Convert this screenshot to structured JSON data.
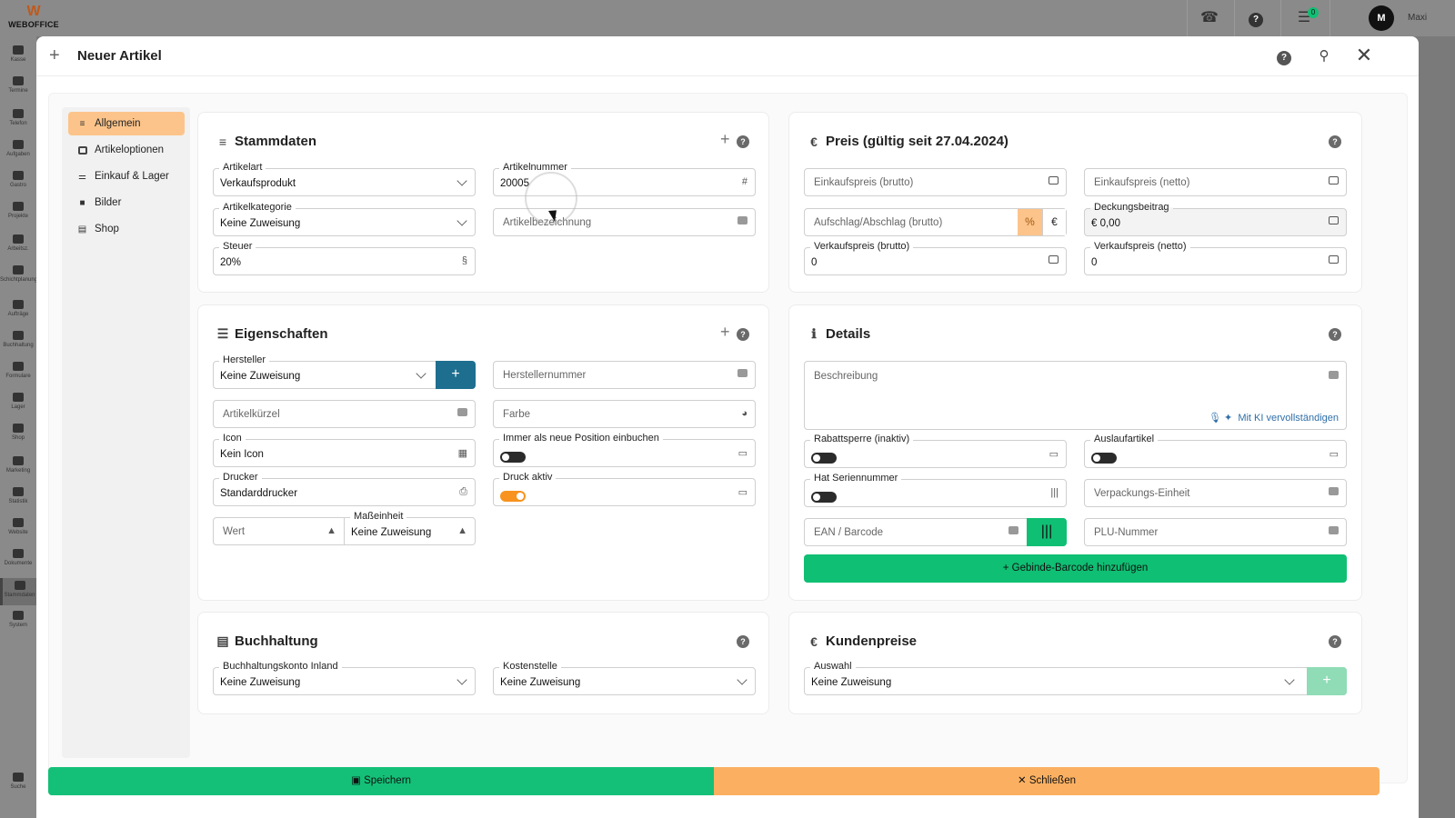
{
  "app": {
    "logo_text": "WEBOFFICE",
    "user_initial": "M",
    "user_name": "Maxi",
    "task_badge": "0"
  },
  "bg_sidebar": [
    "Kasse",
    "Termine",
    "Telefon",
    "Aufgaben",
    "Gastro",
    "Projekte",
    "Arbeitsz.",
    "Schichtplanung",
    "Aufträge",
    "Buchhaltung",
    "Formulare",
    "Lager",
    "Shop",
    "Marketing",
    "Statistik",
    "Website",
    "Dokumente",
    "Stammdaten",
    "System",
    "Suche"
  ],
  "modal": {
    "title": "Neuer Artikel",
    "help": "?"
  },
  "nav": [
    {
      "label": "Allgemein",
      "icon": "database-icon"
    },
    {
      "label": "Artikeloptionen",
      "icon": "options-icon"
    },
    {
      "label": "Einkauf & Lager",
      "icon": "sliders-icon"
    },
    {
      "label": "Bilder",
      "icon": "camera-icon"
    },
    {
      "label": "Shop",
      "icon": "store-icon"
    }
  ],
  "stammdaten": {
    "title": "Stammdaten",
    "artikelart": {
      "label": "Artikelart",
      "value": "Verkaufsprodukt"
    },
    "artikelnummer": {
      "label": "Artikelnummer",
      "value": "20005"
    },
    "artikelkategorie": {
      "label": "Artikelkategorie",
      "value": "Keine Zuweisung"
    },
    "artikelbezeichnung": {
      "placeholder": "Artikelbezeichnung"
    },
    "steuer": {
      "label": "Steuer",
      "value": "20%",
      "icon_glyph": "§"
    }
  },
  "preis": {
    "title": "Preis (gültig seit 27.04.2024)",
    "einkauf_brutto": "Einkaufspreis (brutto)",
    "einkauf_netto": "Einkaufspreis (netto)",
    "aufschlag": "Aufschlag/Abschlag (brutto)",
    "percent_glyph": "%",
    "euro_glyph": "€",
    "deckungsbeitrag": {
      "label": "Deckungsbeitrag",
      "value": "€ 0,00"
    },
    "verkauf_brutto": {
      "label": "Verkaufspreis (brutto)",
      "value": "0"
    },
    "verkauf_netto": {
      "label": "Verkaufspreis (netto)",
      "value": "0"
    }
  },
  "eigenschaften": {
    "title": "Eigenschaften",
    "hersteller": {
      "label": "Hersteller",
      "value": "Keine Zuweisung"
    },
    "herstellernummer": "Herstellernummer",
    "artikelkuerzel": "Artikelkürzel",
    "farbe": "Farbe",
    "icon": {
      "label": "Icon",
      "value": "Kein Icon"
    },
    "immer_neue_position": {
      "label": "Immer als neue Position einbuchen",
      "on": false
    },
    "drucker": {
      "label": "Drucker",
      "value": "Standarddrucker"
    },
    "druck_aktiv": {
      "label": "Druck aktiv",
      "on": true
    },
    "wert": "Wert",
    "masseinheit": {
      "label": "Maßeinheit",
      "value": "Keine Zuweisung"
    }
  },
  "details": {
    "title": "Details",
    "beschreibung": "Beschreibung",
    "ki_link": "Mit KI vervollständigen",
    "rabattsperre": {
      "label": "Rabattsperre (inaktiv)",
      "on": false
    },
    "auslaufartikel": {
      "label": "Auslaufartikel",
      "on": false
    },
    "seriennummer": {
      "label": "Hat Seriennummer",
      "on": false
    },
    "verpackungs_einheit": "Verpackungs-Einheit",
    "ean": "EAN / Barcode",
    "plu": "PLU-Nummer",
    "gebinde_button": "Gebinde-Barcode hinzufügen"
  },
  "buchhaltung": {
    "title": "Buchhaltung",
    "konto": {
      "label": "Buchhaltungskonto Inland",
      "value": "Keine Zuweisung"
    },
    "kostenstelle": {
      "label": "Kostenstelle",
      "value": "Keine Zuweisung"
    }
  },
  "kundenpreise": {
    "title": "Kundenpreise",
    "auswahl": {
      "label": "Auswahl",
      "value": "Keine Zuweisung"
    }
  },
  "footer": {
    "save": "Speichern",
    "close": "Schließen"
  },
  "colors": {
    "accent_orange": "#fbb061",
    "nav_active": "#fcc48a",
    "green": "#0fbf73",
    "teal": "#1e6f8f",
    "toggle_on": "#f7931e"
  }
}
